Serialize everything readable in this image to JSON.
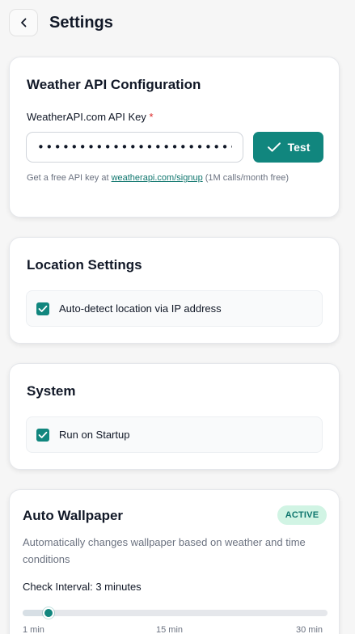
{
  "header": {
    "title": "Settings",
    "back_icon": "chevron-left-icon"
  },
  "weather_api": {
    "title": "Weather API Configuration",
    "api_key_label": "WeatherAPI.com API Key",
    "required_mark": "*",
    "api_key_value": "••••••••••••••••••••••••••••••••",
    "test_button_label": "Test",
    "test_icon": "check-icon",
    "hint_prefix": "Get a free API key at",
    "hint_link": "weatherapi.com/signup",
    "hint_suffix": "(1M calls/month free)"
  },
  "location": {
    "title": "Location Settings",
    "auto_detect_label": "Auto-detect location via IP address",
    "auto_detect_checked": true
  },
  "system": {
    "title": "System",
    "run_on_startup_label": "Run on Startup",
    "run_on_startup_checked": true
  },
  "auto_wallpaper": {
    "title": "Auto Wallpaper",
    "status_badge": "ACTIVE",
    "description": "Automatically changes wallpaper based on weather and time conditions",
    "check_interval_label": "Check Interval: 3 minutes",
    "interval_min": "1 min",
    "interval_mid": "15 min",
    "interval_max": "30 min",
    "interval_value_minutes": 3
  },
  "colors": {
    "accent": "#11867e",
    "badge_background": "#d1f4e4",
    "required": "#dc2626"
  }
}
